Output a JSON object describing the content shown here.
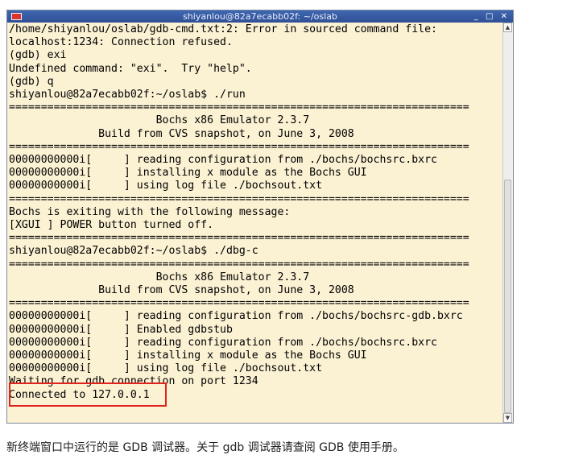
{
  "window": {
    "title": "shiyanlou@82a7ecabb02f: ~/oslab",
    "controls": {
      "minimize": "_",
      "maximize": "□",
      "close": "✕"
    }
  },
  "terminal": {
    "lines": [
      "/home/shiyanlou/oslab/gdb-cmd.txt:2: Error in sourced command file:",
      "localhost:1234: Connection refused.",
      "(gdb) exi",
      "Undefined command: \"exi\".  Try \"help\".",
      "(gdb) q",
      "shiyanlou@82a7ecabb02f:~/oslab$ ./run",
      "========================================================================",
      "                       Bochs x86 Emulator 2.3.7",
      "              Build from CVS snapshot, on June 3, 2008",
      "========================================================================",
      "00000000000i[     ] reading configuration from ./bochs/bochsrc.bxrc",
      "00000000000i[     ] installing x module as the Bochs GUI",
      "00000000000i[     ] using log file ./bochsout.txt",
      "========================================================================",
      "Bochs is exiting with the following message:",
      "[XGUI ] POWER button turned off.",
      "========================================================================",
      "shiyanlou@82a7ecabb02f:~/oslab$ ./dbg-c",
      "========================================================================",
      "                       Bochs x86 Emulator 2.3.7",
      "              Build from CVS snapshot, on June 3, 2008",
      "========================================================================",
      "00000000000i[     ] reading configuration from ./bochs/bochsrc-gdb.bxrc",
      "00000000000i[     ] Enabled gdbstub",
      "00000000000i[     ] reading configuration from ./bochs/bochsrc.bxrc",
      "00000000000i[     ] installing x module as the Bochs GUI",
      "00000000000i[     ] using log file ./bochsout.txt",
      "Waiting for gdb connection on port 1234",
      "Connected to 127.0.0.1"
    ]
  },
  "caption": "新终端窗口中运行的是 GDB 调试器。关于 gdb 调试器请查阅 GDB 使用手册。"
}
